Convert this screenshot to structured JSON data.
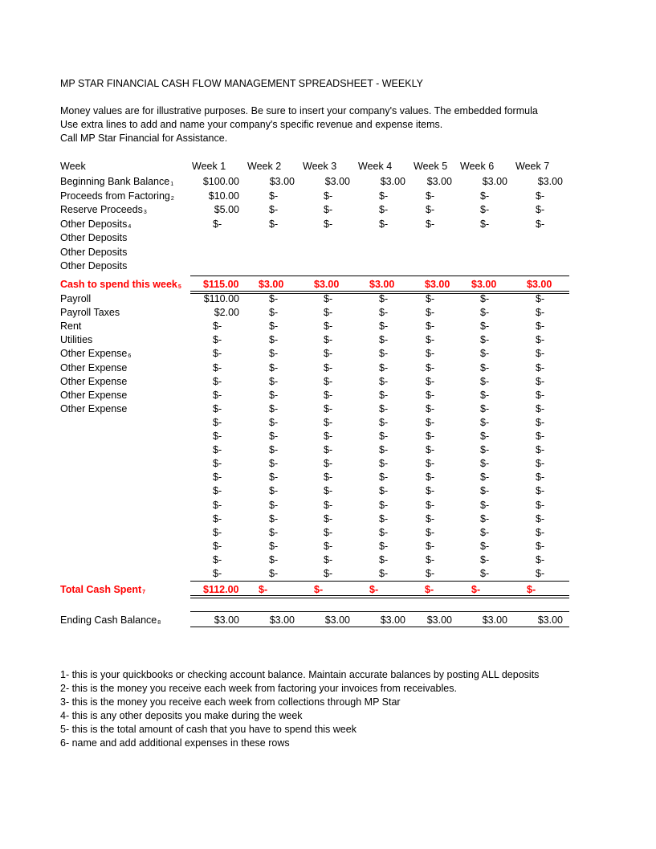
{
  "title": "MP STAR FINANCIAL CASH FLOW MANAGEMENT SPREADSHEET - WEEKLY",
  "intro": [
    "Money values are for illustrative purposes. Be sure to insert your company's values. The embedded formula",
    "Use extra lines to add and name your company's specific revenue and expense items.",
    "Call MP Star Financial for Assistance."
  ],
  "header": {
    "label": "Week",
    "weeks": [
      "Week 1",
      "Week 2",
      "Week 3",
      "Week 4",
      "Week 5",
      "Week 6",
      "Week 7"
    ]
  },
  "deposits": [
    {
      "label": "Beginning Bank Balance",
      "note": "1",
      "values": [
        "$100.00",
        "$3.00",
        "$3.00",
        "$3.00",
        "$3.00",
        "$3.00",
        "$3.00"
      ]
    },
    {
      "label": "Proceeds from Factoring",
      "note": "2",
      "values": [
        "$10.00",
        "$-",
        "$-",
        "$-",
        "$-",
        "$-",
        "$-"
      ]
    },
    {
      "label": "Reserve Proceeds",
      "note": "3",
      "values": [
        "$5.00",
        "$-",
        "$-",
        "$-",
        "$-",
        "$-",
        "$-"
      ]
    },
    {
      "label": "Other Deposits",
      "note": "4",
      "values": [
        "$-",
        "$-",
        "$-",
        "$-",
        "$-",
        "$-",
        "$-"
      ]
    },
    {
      "label": "Other Deposits",
      "note": "",
      "values": [
        "",
        "",
        "",
        "",
        "",
        "",
        ""
      ]
    },
    {
      "label": "Other Deposits",
      "note": "",
      "values": [
        "",
        "",
        "",
        "",
        "",
        "",
        ""
      ]
    },
    {
      "label": "Other Deposits",
      "note": "",
      "values": [
        "",
        "",
        "",
        "",
        "",
        "",
        ""
      ]
    }
  ],
  "cash_to_spend": {
    "label": "Cash to spend this week",
    "note": "5",
    "values": [
      "$115.00",
      "$3.00",
      "$3.00",
      "$3.00",
      "$3.00",
      "$3.00",
      "$3.00"
    ]
  },
  "expenses": [
    {
      "label": "Payroll",
      "note": "",
      "values": [
        "$110.00",
        "$-",
        "$-",
        "$-",
        "$-",
        "$-",
        "$-"
      ]
    },
    {
      "label": "Payroll Taxes",
      "note": "",
      "values": [
        "$2.00",
        "$-",
        "$-",
        "$-",
        "$-",
        "$-",
        "$-"
      ]
    },
    {
      "label": "Rent",
      "note": "",
      "values": [
        "$-",
        "$-",
        "$-",
        "$-",
        "$-",
        "$-",
        "$-"
      ]
    },
    {
      "label": "Utilities",
      "note": "",
      "values": [
        "$-",
        "$-",
        "$-",
        "$-",
        "$-",
        "$-",
        "$-"
      ]
    },
    {
      "label": "Other Expense",
      "note": "6",
      "values": [
        "$-",
        "$-",
        "$-",
        "$-",
        "$-",
        "$-",
        "$-"
      ]
    },
    {
      "label": "Other Expense",
      "note": "",
      "values": [
        "$-",
        "$-",
        "$-",
        "$-",
        "$-",
        "$-",
        "$-"
      ]
    },
    {
      "label": "Other Expense",
      "note": "",
      "values": [
        "$-",
        "$-",
        "$-",
        "$-",
        "$-",
        "$-",
        "$-"
      ]
    },
    {
      "label": "Other Expense",
      "note": "",
      "values": [
        "$-",
        "$-",
        "$-",
        "$-",
        "$-",
        "$-",
        "$-"
      ]
    },
    {
      "label": "Other Expense",
      "note": "",
      "values": [
        "$-",
        "$-",
        "$-",
        "$-",
        "$-",
        "$-",
        "$-"
      ]
    },
    {
      "label": "",
      "note": "",
      "values": [
        "$-",
        "$-",
        "$-",
        "$-",
        "$-",
        "$-",
        "$-"
      ]
    },
    {
      "label": "",
      "note": "",
      "values": [
        "$-",
        "$-",
        "$-",
        "$-",
        "$-",
        "$-",
        "$-"
      ]
    },
    {
      "label": "",
      "note": "",
      "values": [
        "$-",
        "$-",
        "$-",
        "$-",
        "$-",
        "$-",
        "$-"
      ]
    },
    {
      "label": "",
      "note": "",
      "values": [
        "$-",
        "$-",
        "$-",
        "$-",
        "$-",
        "$-",
        "$-"
      ]
    },
    {
      "label": "",
      "note": "",
      "values": [
        "$-",
        "$-",
        "$-",
        "$-",
        "$-",
        "$-",
        "$-"
      ]
    },
    {
      "label": "",
      "note": "",
      "values": [
        "$-",
        "$-",
        "$-",
        "$-",
        "$-",
        "$-",
        "$-"
      ]
    },
    {
      "label": "",
      "note": "",
      "values": [
        "$-",
        "$-",
        "$-",
        "$-",
        "$-",
        "$-",
        "$-"
      ]
    },
    {
      "label": "",
      "note": "",
      "values": [
        "$-",
        "$-",
        "$-",
        "$-",
        "$-",
        "$-",
        "$-"
      ]
    },
    {
      "label": "",
      "note": "",
      "values": [
        "$-",
        "$-",
        "$-",
        "$-",
        "$-",
        "$-",
        "$-"
      ]
    },
    {
      "label": "",
      "note": "",
      "values": [
        "$-",
        "$-",
        "$-",
        "$-",
        "$-",
        "$-",
        "$-"
      ]
    },
    {
      "label": "",
      "note": "",
      "values": [
        "$-",
        "$-",
        "$-",
        "$-",
        "$-",
        "$-",
        "$-"
      ]
    },
    {
      "label": "",
      "note": "",
      "values": [
        "$-",
        "$-",
        "$-",
        "$-",
        "$-",
        "$-",
        "$-"
      ]
    }
  ],
  "total_cash_spent": {
    "label": "Total Cash Spent",
    "note": "7",
    "values": [
      "$112.00",
      "$-",
      "$-",
      "$-",
      "$-",
      "$-",
      "$-"
    ]
  },
  "ending_balance": {
    "label": "Ending Cash Balance",
    "note": "8",
    "values": [
      "$3.00",
      "$3.00",
      "$3.00",
      "$3.00",
      "$3.00",
      "$3.00",
      "$3.00"
    ]
  },
  "notes": [
    "1- this is your quickbooks or checking account balance. Maintain accurate balances by posting ALL deposits",
    "2- this is the money you receive each week from factoring your invoices from receivables.",
    "3- this is the money you receive each week from collections through MP Star",
    "4- this is any other deposits you make during the week",
    "5- this is the total amount of cash that you have to spend this week",
    "6- name and add additional expenses in these rows"
  ],
  "colors": {
    "highlight": "#ff0000"
  }
}
